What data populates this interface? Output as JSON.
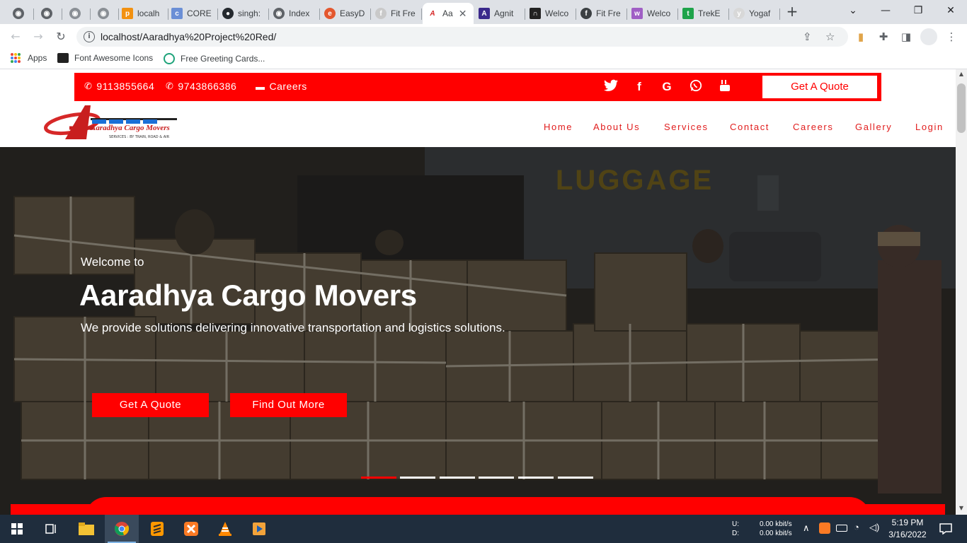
{
  "browser": {
    "tabs": [
      {
        "label": "",
        "icon": "globe-icon"
      },
      {
        "label": "",
        "icon": "globe-icon"
      },
      {
        "label": "",
        "icon": "globe-icon"
      },
      {
        "label": "",
        "icon": "globe-icon"
      },
      {
        "label": "localh",
        "icon": "phpmyadmin-icon"
      },
      {
        "label": "CORE",
        "icon": "core-icon"
      },
      {
        "label": "singh:",
        "icon": "github-icon"
      },
      {
        "label": "Index",
        "icon": "globe-icon"
      },
      {
        "label": "EasyD",
        "icon": "easy-icon"
      },
      {
        "label": "Fit Fre",
        "icon": "fit-icon"
      },
      {
        "label": "Aa",
        "icon": "aaradhya-icon",
        "active": true
      },
      {
        "label": "Agnit",
        "icon": "agnit-icon"
      },
      {
        "label": "Welco",
        "icon": "arch-icon"
      },
      {
        "label": "Fit Fre",
        "icon": "fit-icon"
      },
      {
        "label": "Welco",
        "icon": "welcome-icon"
      },
      {
        "label": "TrekE",
        "icon": "trek-icon"
      },
      {
        "label": "Yogaf",
        "icon": "yoga-icon"
      }
    ],
    "url": "localhost/Aaradhya%20Project%20Red/",
    "bookmarks": [
      "Apps",
      "Font Awesome Icons",
      "Free Greeting Cards..."
    ]
  },
  "site": {
    "topbar": {
      "phone1": "9113855664",
      "phone2": "9743866386",
      "careers": "Careers",
      "quote_button": "Get A Quote"
    },
    "logo_text": "Aaradhya Cargo Movers",
    "logo_tagline": "SERVICES : BY TRAIN, ROAD & AIR",
    "nav": [
      "Home",
      "About Us",
      "Services",
      "Contact",
      "Careers",
      "Gallery",
      "Login"
    ],
    "hero": {
      "welcome": "Welcome to",
      "title": "Aaradhya Cargo Movers",
      "subtitle": "We provide solutions delivering innovative transportation and logistics solutions.",
      "button1": "Get A Quote",
      "button2": "Find Out More",
      "background_sign": "LUGGAGE",
      "slide_count": 6,
      "active_slide": 1
    }
  },
  "taskbar": {
    "net_up_label": "U:",
    "net_down_label": "D:",
    "net_up": "0.00 kbit/s",
    "net_down": "0.00 kbit/s",
    "time": "5:19 PM",
    "date": "3/16/2022"
  },
  "colors": {
    "brand_red": "#ff0000",
    "chrome_tabbar": "#dee1e6",
    "taskbar": "#1f2d3d"
  }
}
